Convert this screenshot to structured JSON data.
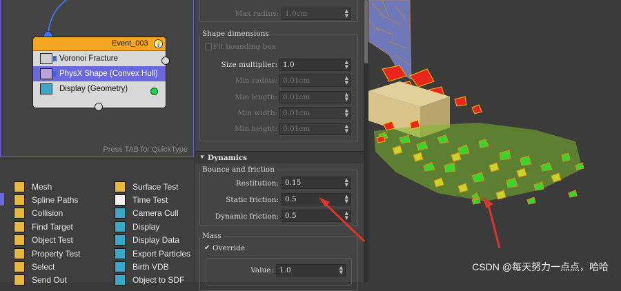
{
  "particle_view": {
    "hint": "Press TAB for QuickType",
    "event": {
      "title": "Event_003",
      "operators": [
        {
          "label": "Voronoi Fracture",
          "icon": "voronoi-icon",
          "selected": false
        },
        {
          "label": "PhysX Shape (Convex Hull)",
          "icon": "physx-shape-icon",
          "selected": true
        },
        {
          "label": "Display (Geometry)",
          "icon": "display-icon",
          "selected": false
        }
      ]
    }
  },
  "depot": {
    "left": [
      "Mesh",
      "Spline Paths",
      "Collision",
      "Find Target",
      "Object Test",
      "Property Test",
      "Select",
      "Send Out"
    ],
    "right": [
      "Surface Test",
      "Time Test",
      "Camera Cull",
      "Display",
      "Display Data",
      "Export Particles",
      "Birth VDB",
      "Object to SDF"
    ]
  },
  "properties": {
    "max_radius": {
      "label": "Max radius:",
      "value": "1.0cm"
    },
    "shape_dimensions": {
      "title": "Shape dimensions",
      "fit_bounding_box": "Fit bounding box",
      "size_multiplier": {
        "label": "Size multiplier:",
        "value": "1.0"
      },
      "min_radius": {
        "label": "Min radius:",
        "value": "0.01cm"
      },
      "min_length": {
        "label": "Min length:",
        "value": "0.01cm"
      },
      "min_width": {
        "label": "Min width:",
        "value": "0.01cm"
      },
      "min_height": {
        "label": "Min height:",
        "value": "0.01cm"
      }
    },
    "dynamics": {
      "title": "Dynamics",
      "bounce_title": "Bounce and friction",
      "restitution": {
        "label": "Restitution:",
        "value": "0.15"
      },
      "static_friction": {
        "label": "Static friction:",
        "value": "0.5"
      },
      "dynamic_friction": {
        "label": "Dynamic friction:",
        "value": "0.5"
      }
    },
    "mass": {
      "title": "Mass",
      "override_label": "Override",
      "value": {
        "label": "Value:",
        "value": "1.0"
      }
    }
  },
  "watermark": "CSDN @每天努力一点点，哈哈"
}
